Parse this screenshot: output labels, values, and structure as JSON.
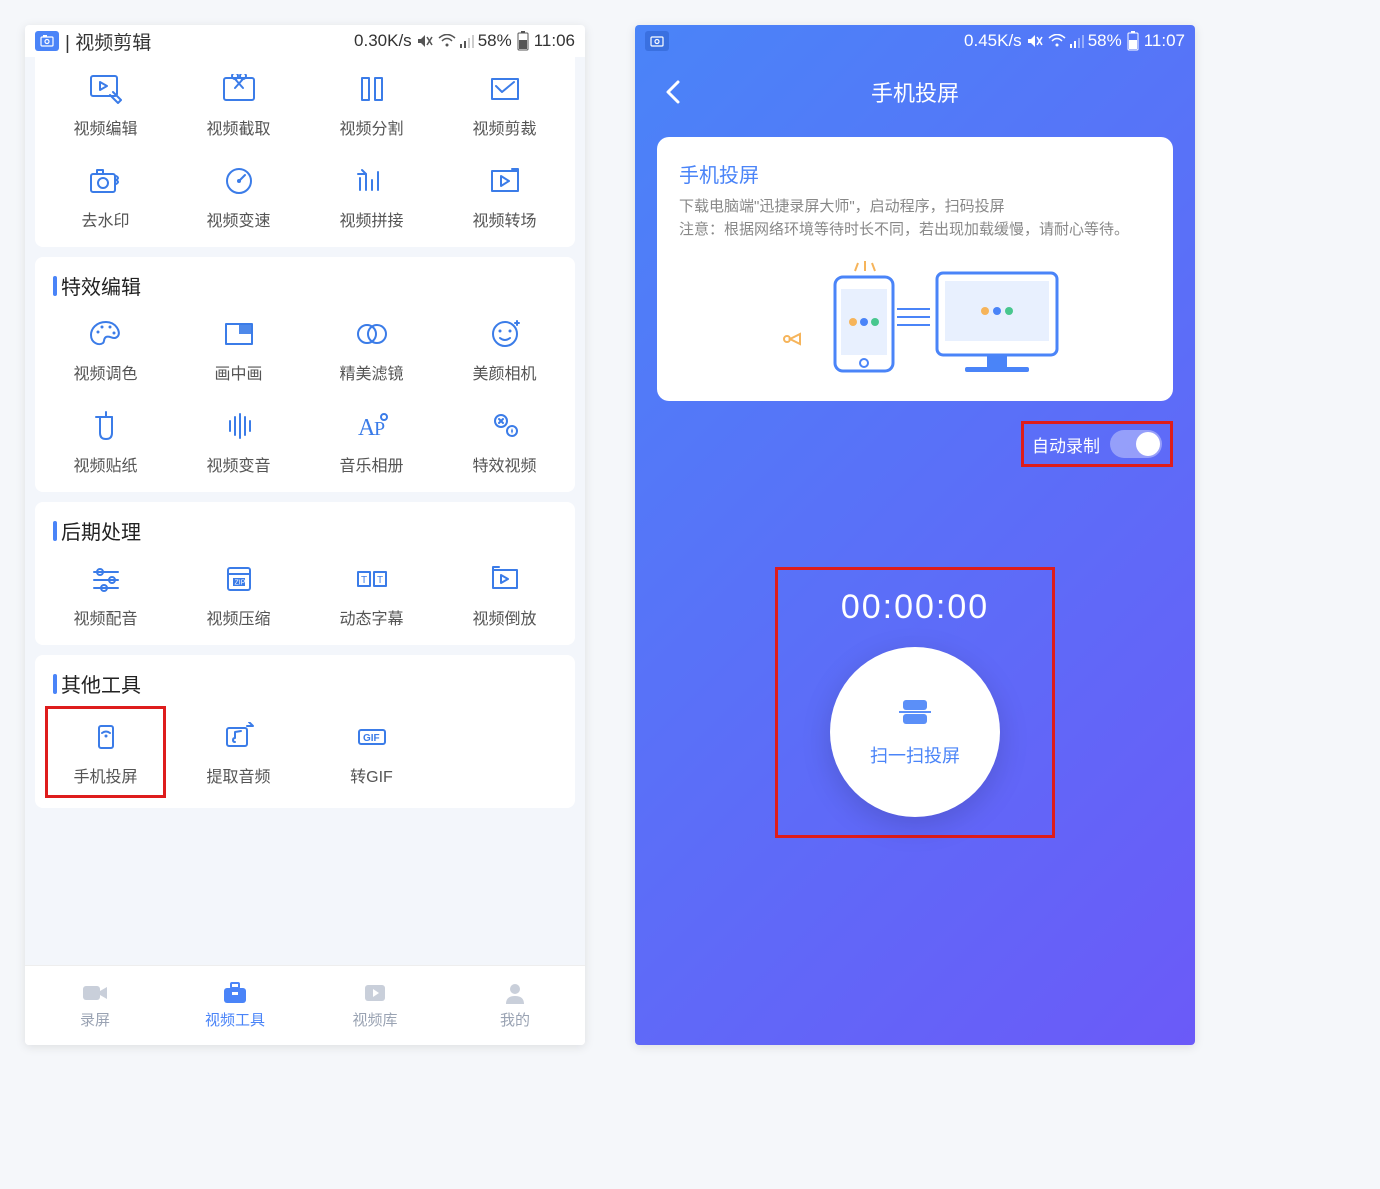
{
  "left": {
    "status": {
      "title": "| 视频剪辑",
      "speed": "0.30K/s",
      "battery": "58%",
      "time": "11:06"
    },
    "sections": {
      "editing": {
        "items": [
          {
            "label": "视频编辑"
          },
          {
            "label": "视频截取"
          },
          {
            "label": "视频分割"
          },
          {
            "label": "视频剪裁"
          },
          {
            "label": "去水印"
          },
          {
            "label": "视频变速"
          },
          {
            "label": "视频拼接"
          },
          {
            "label": "视频转场"
          }
        ]
      },
      "effects": {
        "title": "特效编辑",
        "items": [
          {
            "label": "视频调色"
          },
          {
            "label": "画中画"
          },
          {
            "label": "精美滤镜"
          },
          {
            "label": "美颜相机"
          },
          {
            "label": "视频贴纸"
          },
          {
            "label": "视频变音"
          },
          {
            "label": "音乐相册"
          },
          {
            "label": "特效视频"
          }
        ]
      },
      "post": {
        "title": "后期处理",
        "items": [
          {
            "label": "视频配音"
          },
          {
            "label": "视频压缩"
          },
          {
            "label": "动态字幕"
          },
          {
            "label": "视频倒放"
          }
        ]
      },
      "other": {
        "title": "其他工具",
        "items": [
          {
            "label": "手机投屏"
          },
          {
            "label": "提取音频"
          },
          {
            "label": "转GIF"
          }
        ]
      }
    },
    "nav": [
      {
        "label": "录屏"
      },
      {
        "label": "视频工具"
      },
      {
        "label": "视频库"
      },
      {
        "label": "我的"
      }
    ]
  },
  "right": {
    "status": {
      "speed": "0.45K/s",
      "battery": "58%",
      "time": "11:07"
    },
    "header": "手机投屏",
    "card": {
      "title": "手机投屏",
      "desc1": "下载电脑端\"迅捷录屏大师\"，启动程序，扫码投屏",
      "desc2": "注意：根据网络环境等待时长不同，若出现加载缓慢，请耐心等待。"
    },
    "autorec": "自动录制",
    "timer": "00:00:00",
    "scan": "扫一扫投屏"
  }
}
